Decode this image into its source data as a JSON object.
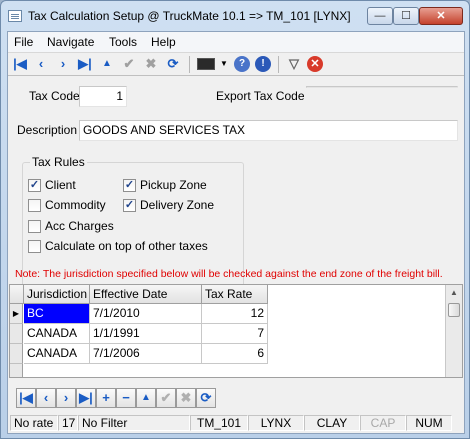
{
  "window": {
    "title": "Tax Calculation Setup @ TruckMate 10.1 => TM_101 [LYNX]",
    "buttons": {
      "minimize": "—",
      "maximize": "☐",
      "close": "✕"
    }
  },
  "menu": [
    {
      "label": "File"
    },
    {
      "label": "Navigate"
    },
    {
      "label": "Tools"
    },
    {
      "label": "Help"
    }
  ],
  "toolbar": {
    "icons": [
      "first-icon",
      "prior-icon",
      "next-icon",
      "last-icon",
      "insert-icon",
      "post-icon",
      "cancel-icon",
      "refresh-icon",
      "monitor-icon",
      "dropdown-icon",
      "help-icon",
      "info-icon",
      "filter-icon",
      "close-icon"
    ]
  },
  "form": {
    "tax_code_label": "Tax Code",
    "tax_code_value": "1",
    "export_tax_code_label": "Export Tax Code",
    "export_tax_code_value": "",
    "description_label": "Description",
    "description_value": "GOODS AND SERVICES TAX"
  },
  "tax_rules": {
    "title": "Tax Rules",
    "client": {
      "label": "Client",
      "checked": true
    },
    "pickup_zone": {
      "label": "Pickup Zone",
      "checked": true
    },
    "commodity": {
      "label": "Commodity",
      "checked": false
    },
    "delivery_zone": {
      "label": "Delivery Zone",
      "checked": true
    },
    "acc_charges": {
      "label": "Acc Charges",
      "checked": false
    },
    "calc_on_top": {
      "label": "Calculate on top of other taxes",
      "checked": false
    }
  },
  "note": "Note: The jurisdiction specified below will be checked against the end zone of the freight bill.",
  "grid": {
    "columns": [
      "Jurisdiction",
      "Effective Date",
      "Tax Rate"
    ],
    "rows": [
      {
        "jurisdiction": "BC",
        "effective_date": "7/1/2010",
        "tax_rate": "12"
      },
      {
        "jurisdiction": "CANADA",
        "effective_date": "1/1/1991",
        "tax_rate": "7"
      },
      {
        "jurisdiction": "CANADA",
        "effective_date": "7/1/2006",
        "tax_rate": "6"
      }
    ]
  },
  "status": {
    "rate": "No rate",
    "count": "17",
    "filter": "No Filter",
    "db": "TM_101",
    "server": "LYNX",
    "user": "CLAY",
    "cap": "CAP",
    "num": "NUM"
  },
  "colors": {
    "selected_cell": "#0000ff",
    "note_text": "#e00000",
    "toolbar_blue": "#1a5cc4"
  }
}
